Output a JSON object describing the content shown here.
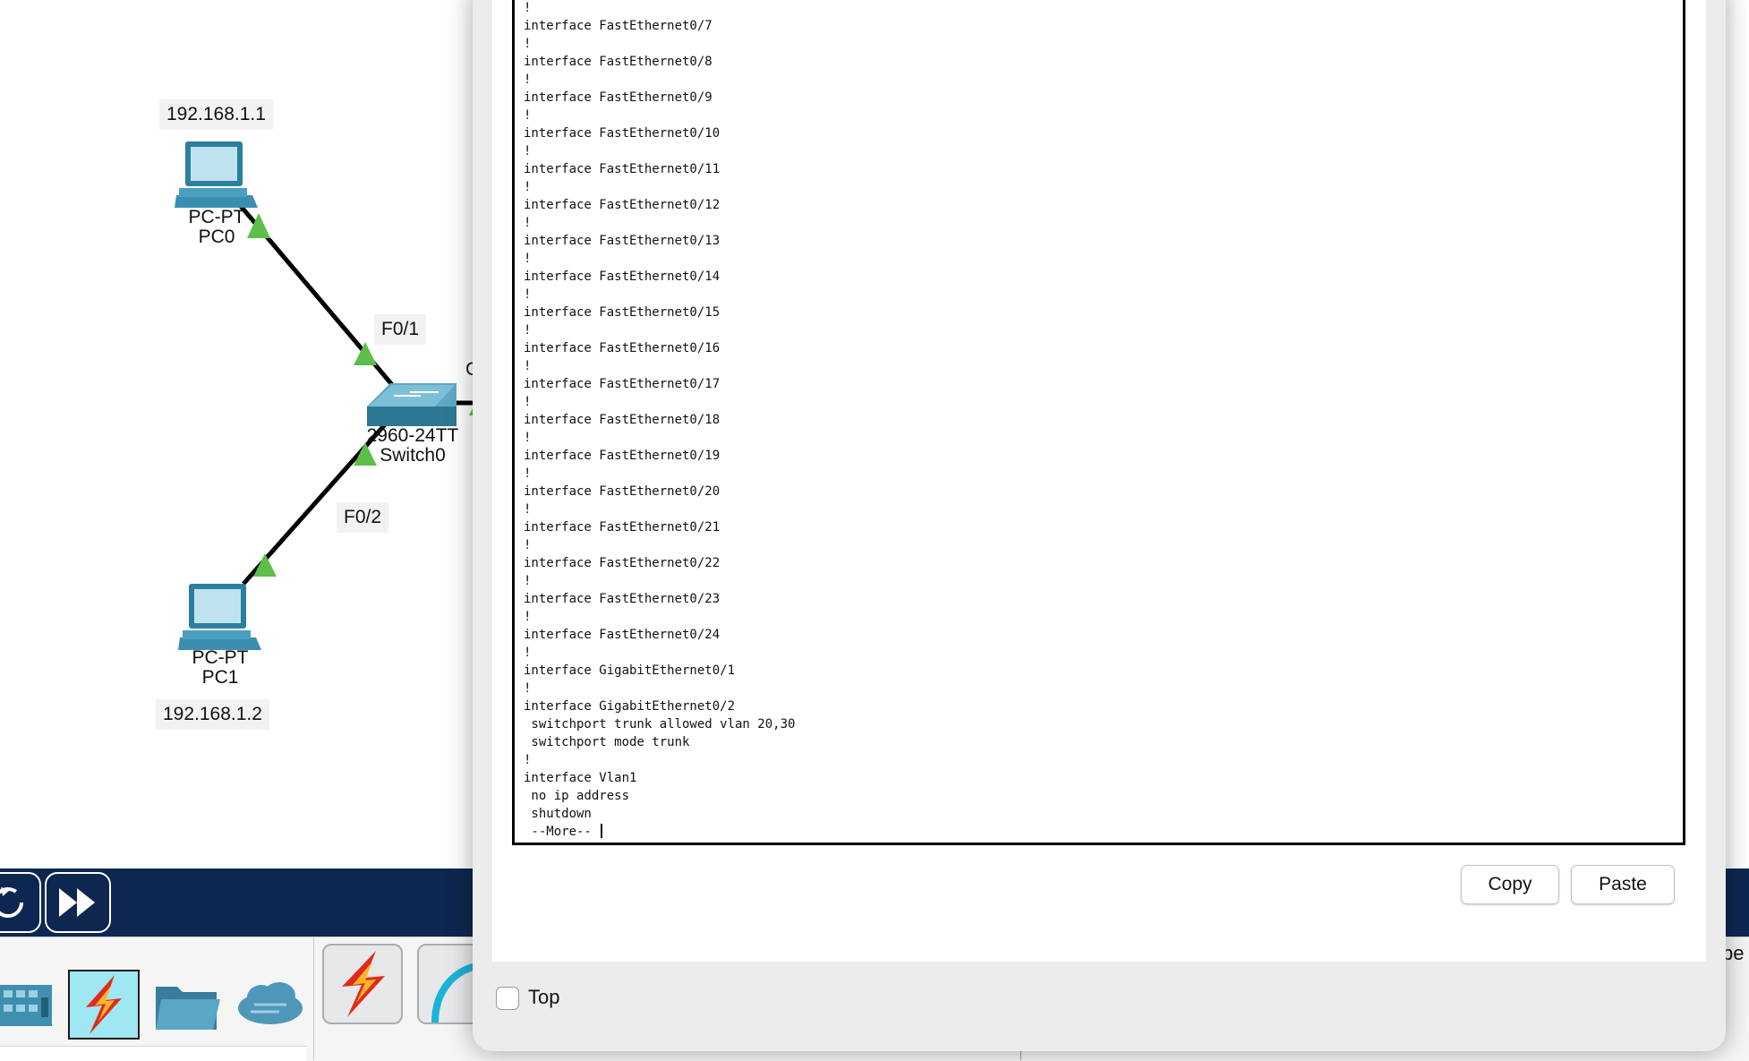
{
  "topology": {
    "pc0": {
      "ip": "192.168.1.1",
      "model": "PC-PT",
      "name": "PC0"
    },
    "pc1": {
      "ip": "192.168.1.2",
      "model": "PC-PT",
      "name": "PC1"
    },
    "switch0": {
      "model": "2960-24TT",
      "name": "Switch0"
    },
    "port_labels": {
      "f01": "F0/1",
      "f02": "F0/2",
      "partial": "G"
    },
    "link_color": "#000000",
    "link_indicator_color": "#5cbf4a"
  },
  "sim_bar": {
    "reset_icon": "reset-cycle-icon",
    "fast_forward_icon": "fast-forward-icon"
  },
  "device_tray": {
    "icons": [
      "network-device-icon",
      "connections-lightning-icon",
      "folder-icon",
      "cloud-icon",
      "lightning-icon",
      "gauge-arc-icon"
    ],
    "selected_color": "#9fe7f2",
    "edge_text": "pe"
  },
  "dialog": {
    "terminal_lines": [
      "!",
      "interface FastEthernet0/7",
      "!",
      "interface FastEthernet0/8",
      "!",
      "interface FastEthernet0/9",
      "!",
      "interface FastEthernet0/10",
      "!",
      "interface FastEthernet0/11",
      "!",
      "interface FastEthernet0/12",
      "!",
      "interface FastEthernet0/13",
      "!",
      "interface FastEthernet0/14",
      "!",
      "interface FastEthernet0/15",
      "!",
      "interface FastEthernet0/16",
      "!",
      "interface FastEthernet0/17",
      "!",
      "interface FastEthernet0/18",
      "!",
      "interface FastEthernet0/19",
      "!",
      "interface FastEthernet0/20",
      "!",
      "interface FastEthernet0/21",
      "!",
      "interface FastEthernet0/22",
      "!",
      "interface FastEthernet0/23",
      "!",
      "interface FastEthernet0/24",
      "!",
      "interface GigabitEthernet0/1",
      "!",
      "interface GigabitEthernet0/2",
      " switchport trunk allowed vlan 20,30",
      " switchport mode trunk",
      "!",
      "interface Vlan1",
      " no ip address",
      " shutdown"
    ],
    "more_prompt": " --More-- ",
    "copy_label": "Copy",
    "paste_label": "Paste",
    "top_checkbox_label": "Top",
    "top_checked": false
  }
}
